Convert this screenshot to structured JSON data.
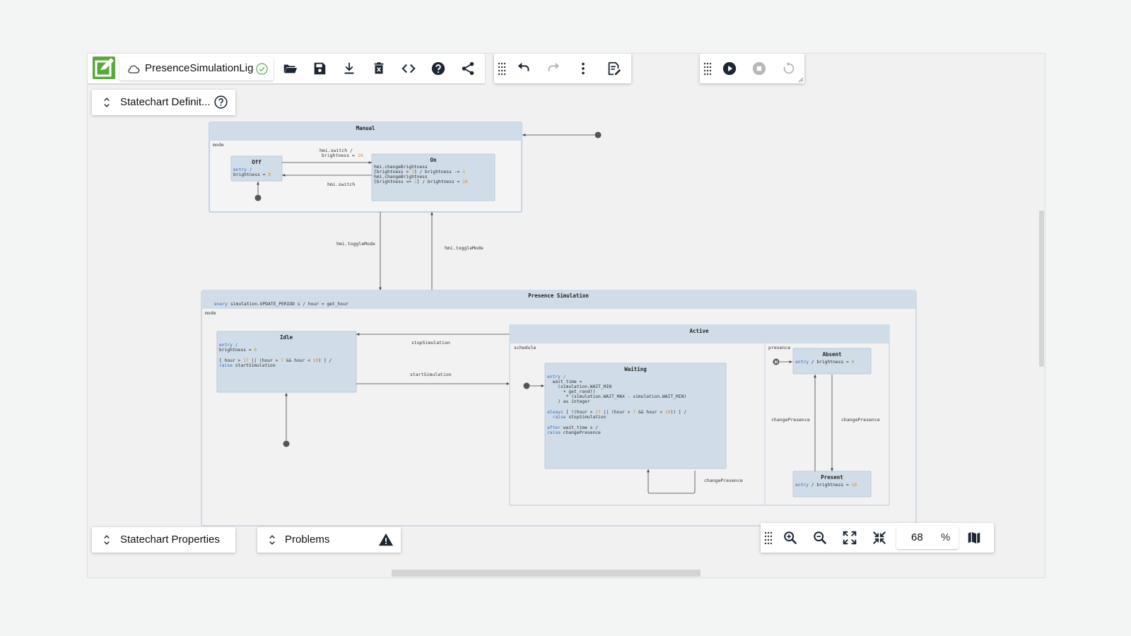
{
  "app": {
    "filename": "PresenceSimulationLig",
    "statechart_definition_label": "Statechart Definit...",
    "statechart_properties_label": "Statechart Properties",
    "problems_label": "Problems",
    "zoom_value": "68",
    "zoom_unit": "%"
  },
  "diagram": {
    "manual": {
      "title": "Manual",
      "region": "mode",
      "off_title": "Off",
      "off_entry_kw": "entry /",
      "off_entry_code": "brightness = ",
      "off_entry_num": "0",
      "on_title": "On",
      "on_line1": "hmi.changeBrightness",
      "on_line2_code": "[brightness > ",
      "on_line2_num1": "1",
      "on_line2_code2": "] / brightness -= ",
      "on_line2_num2": "1",
      "on_line3": "hmi.changeBrightness",
      "on_line4_code": "[brightness <= ",
      "on_line4_num1": "1",
      "on_line4_code2": "] / brightness = ",
      "on_line4_num2": "10",
      "t_off_on_1": "hmi.switch /",
      "t_off_on_2": "brightness = ",
      "t_off_on_num": "10",
      "t_on_off": "hmi.switch"
    },
    "toggle_down": "hmi.toggleMode",
    "toggle_up": "hmi.toggleMode",
    "presence": {
      "title": "Presence Simulation",
      "every_kw": "every",
      "every_code": "simulation.UPDATE_PERIOD s /  hour = get_hour",
      "region": "mode",
      "idle_title": "Idle",
      "idle_entry_kw": "entry /",
      "idle_entry_code": "brightness = ",
      "idle_entry_num": "0",
      "idle_guard_1": "[ hour > ",
      "idle_guard_n1": "17",
      "idle_guard_2": " || (hour > ",
      "idle_guard_n2": "7",
      "idle_guard_3": " && hour < ",
      "idle_guard_n3": "10",
      "idle_guard_4": ") ] /",
      "idle_raise_kw": "raise",
      "idle_raise_code": " startSimulation",
      "stop_label": "stopSimulation",
      "start_label": "startSimulation",
      "active_title": "Active",
      "schedule_region": "schedule",
      "presence_region": "presence",
      "waiting_title": "Waiting",
      "w1_kw": "entry /",
      "w2": "  wait_time =",
      "w3": "    (simulation.WAIT_MIN",
      "w4": "      + get_rand()",
      "w5": "       * (simulation.WAIT_MAX - simulation.WAIT_MIN)",
      "w6": "    ) as integer",
      "w7_kw": "always",
      "w7": " [ !(hour > ",
      "w7_n1": "17",
      "w7b": " || (hour > ",
      "w7_n2": "7",
      "w7c": " && hour < ",
      "w7_n3": "10",
      "w7d": ")) ] /",
      "w8_kw": "  raise",
      "w8": " stopSimulation",
      "w9_kw": "after",
      "w9": " wait_time s /",
      "w10_kw": "raise",
      "w10": " changePresence",
      "loop_label": "changePresence",
      "absent_title": "Absent",
      "absent_kw": "entry",
      "absent_code": " / brightness = ",
      "absent_num": "0",
      "present_title": "Present",
      "present_kw": "entry",
      "present_code": " / brightness = ",
      "present_num": "10",
      "cp_left": "changePresence",
      "cp_right": "changePresence",
      "history": "H"
    }
  },
  "colors": {
    "accent_green": "#5aa83b",
    "state_fill": "#d0dce8",
    "state_header": "#cfdbe7",
    "dark_icon": "#1c2733",
    "check_green": "#66bb6a"
  },
  "icons": [
    "logo-icon",
    "cloud-icon",
    "check-circle-icon",
    "folder-open-icon",
    "save-icon",
    "download-icon",
    "delete-icon",
    "code-icon",
    "help-icon",
    "share-icon",
    "undo-icon",
    "redo-icon",
    "more-vert-icon",
    "edit-note-icon",
    "play-icon",
    "stop-icon",
    "reset-icon",
    "zoom-in-icon",
    "zoom-out-icon",
    "fit-icon",
    "collapse-icon",
    "map-icon",
    "warning-icon",
    "expand-icon"
  ]
}
